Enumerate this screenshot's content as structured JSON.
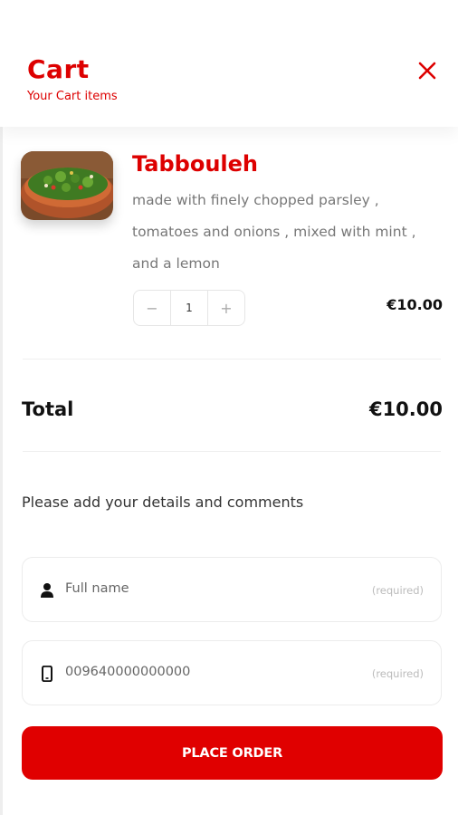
{
  "header": {
    "title": "Cart",
    "subtitle": "Your Cart items",
    "close_icon": "close-icon"
  },
  "cart": {
    "items": [
      {
        "name": "Tabbouleh",
        "description": "made with finely chopped parsley , tomatoes and onions , mixed with mint , and a lemon",
        "quantity": "1",
        "decrement_label": "−",
        "increment_label": "+",
        "price": "€10.00"
      }
    ],
    "total_label": "Total",
    "total_value": "€10.00"
  },
  "details": {
    "label": "Please add your details and comments",
    "name_field": {
      "placeholder": "Full name",
      "required_label": "(required)",
      "icon": "person-icon"
    },
    "phone_field": {
      "value": "009640000000000",
      "required_label": "(required)",
      "icon": "phone-icon"
    }
  },
  "actions": {
    "place_order_label": "PLACE ORDER"
  },
  "colors": {
    "accent": "#dd0000",
    "button": "#e00000"
  }
}
